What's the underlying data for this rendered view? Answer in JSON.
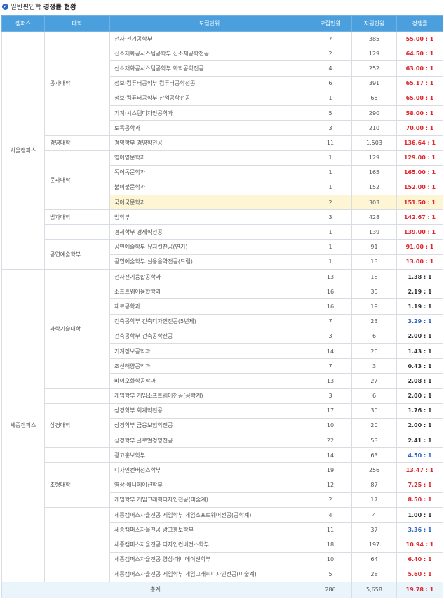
{
  "title": {
    "prefix": "일반편입학",
    "main": "경쟁률 현황"
  },
  "headers": {
    "campus": "캠퍼스",
    "college": "대학",
    "unit": "모집단위",
    "quota": "모집인원",
    "applicants": "지원인원",
    "rate": "경쟁률"
  },
  "campuses": {
    "seoul": "서울캠퍼스",
    "sejong": "세종캠퍼스"
  },
  "colleges": {
    "engineering": "공과대학",
    "business": "경영대학",
    "liberal": "문과대학",
    "law": "법과대학",
    "performing": "공연예술학부",
    "scitech": "과학기술대학",
    "commerce": "상경대학",
    "design": "조형대학"
  },
  "rows": [
    {
      "unit": "전자·전기공학부",
      "quota": "7",
      "applicants": "385",
      "rate": "55.00 : 1",
      "color": "red"
    },
    {
      "unit": "신소재화공시스템공학부 신소재공학전공",
      "quota": "2",
      "applicants": "129",
      "rate": "64.50 : 1",
      "color": "red"
    },
    {
      "unit": "신소재화공시스템공학부 화학공학전공",
      "quota": "4",
      "applicants": "252",
      "rate": "63.00 : 1",
      "color": "red"
    },
    {
      "unit": "정보·컴퓨터공학부 컴퓨터공학전공",
      "quota": "6",
      "applicants": "391",
      "rate": "65.17 : 1",
      "color": "red"
    },
    {
      "unit": "정보·컴퓨터공학부 산업공학전공",
      "quota": "1",
      "applicants": "65",
      "rate": "65.00 : 1",
      "color": "red"
    },
    {
      "unit": "기계·시스템디자인공학과",
      "quota": "5",
      "applicants": "290",
      "rate": "58.00 : 1",
      "color": "red"
    },
    {
      "unit": "토목공학과",
      "quota": "3",
      "applicants": "210",
      "rate": "70.00 : 1",
      "color": "red"
    },
    {
      "unit": "경영학부 경영학전공",
      "quota": "11",
      "applicants": "1,503",
      "rate": "136.64 : 1",
      "color": "red"
    },
    {
      "unit": "영어영문학과",
      "quota": "1",
      "applicants": "129",
      "rate": "129.00 : 1",
      "color": "red"
    },
    {
      "unit": "독어독문학과",
      "quota": "1",
      "applicants": "165",
      "rate": "165.00 : 1",
      "color": "red"
    },
    {
      "unit": "불어불문학과",
      "quota": "1",
      "applicants": "152",
      "rate": "152.00 : 1",
      "color": "red"
    },
    {
      "unit": "국어국문학과",
      "quota": "2",
      "applicants": "303",
      "rate": "151.50 : 1",
      "color": "red"
    },
    {
      "unit": "법학부",
      "quota": "3",
      "applicants": "428",
      "rate": "142.67 : 1",
      "color": "red"
    },
    {
      "unit": "경제학부 경제학전공",
      "quota": "1",
      "applicants": "139",
      "rate": "139.00 : 1",
      "color": "red"
    },
    {
      "unit": "공연예술학부 뮤지컬전공(연기)",
      "quota": "1",
      "applicants": "91",
      "rate": "91.00 : 1",
      "color": "red"
    },
    {
      "unit": "공연예술학부 실용음악전공(드럼)",
      "quota": "1",
      "applicants": "13",
      "rate": "13.00 : 1",
      "color": "red"
    },
    {
      "unit": "전자전기융합공학과",
      "quota": "13",
      "applicants": "18",
      "rate": "1.38 : 1",
      "color": "dark"
    },
    {
      "unit": "소프트웨어융합학과",
      "quota": "16",
      "applicants": "35",
      "rate": "2.19 : 1",
      "color": "dark"
    },
    {
      "unit": "재료공학과",
      "quota": "16",
      "applicants": "19",
      "rate": "1.19 : 1",
      "color": "dark"
    },
    {
      "unit": "건축공학부 건축디자인전공(5년제)",
      "quota": "7",
      "applicants": "23",
      "rate": "3.29 : 1",
      "color": "blue"
    },
    {
      "unit": "건축공학부 건축공학전공",
      "quota": "3",
      "applicants": "6",
      "rate": "2.00 : 1",
      "color": "dark"
    },
    {
      "unit": "기계정보공학과",
      "quota": "14",
      "applicants": "20",
      "rate": "1.43 : 1",
      "color": "dark"
    },
    {
      "unit": "조선해양공학과",
      "quota": "7",
      "applicants": "3",
      "rate": "0.43 : 1",
      "color": "dark"
    },
    {
      "unit": "바이오화학공학과",
      "quota": "13",
      "applicants": "27",
      "rate": "2.08 : 1",
      "color": "dark"
    },
    {
      "unit": "게임학부 게임소프트웨어전공(공학계)",
      "quota": "3",
      "applicants": "6",
      "rate": "2.00 : 1",
      "color": "dark"
    },
    {
      "unit": "상경학부 회계학전공",
      "quota": "17",
      "applicants": "30",
      "rate": "1.76 : 1",
      "color": "dark"
    },
    {
      "unit": "상경학부 금융보험학전공",
      "quota": "10",
      "applicants": "20",
      "rate": "2.00 : 1",
      "color": "dark"
    },
    {
      "unit": "상경학부 글로벌경영전공",
      "quota": "22",
      "applicants": "53",
      "rate": "2.41 : 1",
      "color": "dark"
    },
    {
      "unit": "광고홍보학부",
      "quota": "14",
      "applicants": "63",
      "rate": "4.50 : 1",
      "color": "blue"
    },
    {
      "unit": "디자인컨버전스학부",
      "quota": "19",
      "applicants": "256",
      "rate": "13.47 : 1",
      "color": "red"
    },
    {
      "unit": "영상·애니메이션학부",
      "quota": "12",
      "applicants": "87",
      "rate": "7.25 : 1",
      "color": "red"
    },
    {
      "unit": "게임학부 게임그래픽디자인전공(미술계)",
      "quota": "2",
      "applicants": "17",
      "rate": "8.50 : 1",
      "color": "red"
    },
    {
      "unit": "세종캠퍼스자율전공 게임학부 게임소프트웨어전공(공학계)",
      "quota": "4",
      "applicants": "4",
      "rate": "1.00 : 1",
      "color": "dark"
    },
    {
      "unit": "세종캠퍼스자율전공 광고홍보학부",
      "quota": "11",
      "applicants": "37",
      "rate": "3.36 : 1",
      "color": "blue"
    },
    {
      "unit": "세종캠퍼스자율전공 디자인컨버전스학부",
      "quota": "18",
      "applicants": "197",
      "rate": "10.94 : 1",
      "color": "red"
    },
    {
      "unit": "세종캠퍼스자율전공 영상·애니메이션학부",
      "quota": "10",
      "applicants": "64",
      "rate": "6.40 : 1",
      "color": "red"
    },
    {
      "unit": "세종캠퍼스자율전공 게임학부 게임그래픽디자인전공(미술계)",
      "quota": "5",
      "applicants": "28",
      "rate": "5.60 : 1",
      "color": "red"
    }
  ],
  "total": {
    "label": "총계",
    "quota": "286",
    "applicants": "5,658",
    "rate": "19.78 : 1"
  },
  "colors": {
    "header": "#4a9fdc",
    "red": "#e0272d",
    "blue": "#2c62c5",
    "highlight": "#fdf5d3",
    "total_bg": "#eaf4fb"
  }
}
